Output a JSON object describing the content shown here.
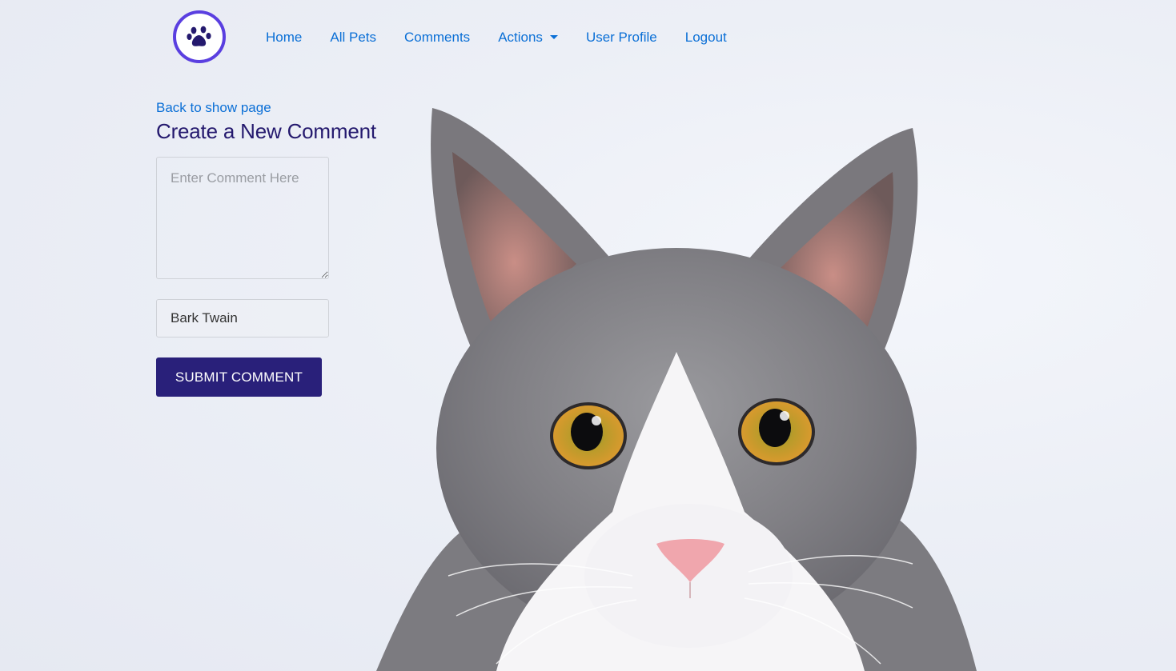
{
  "nav": {
    "logo_icon": "paw-icon",
    "links": [
      "Home",
      "All Pets",
      "Comments",
      "Actions",
      "User Profile",
      "Logout"
    ],
    "link_color": "#0a6fd6"
  },
  "page": {
    "back_link": "Back to show page",
    "title": "Create a New Comment",
    "title_color": "#24196e"
  },
  "form": {
    "comment_placeholder": "Enter Comment Here",
    "comment_value": "",
    "author_value": "Bark Twain",
    "submit_label": "SUBMIT COMMENT",
    "submit_color": "#29207a"
  },
  "background": {
    "subject": "grey-and-white-cat-photo"
  }
}
